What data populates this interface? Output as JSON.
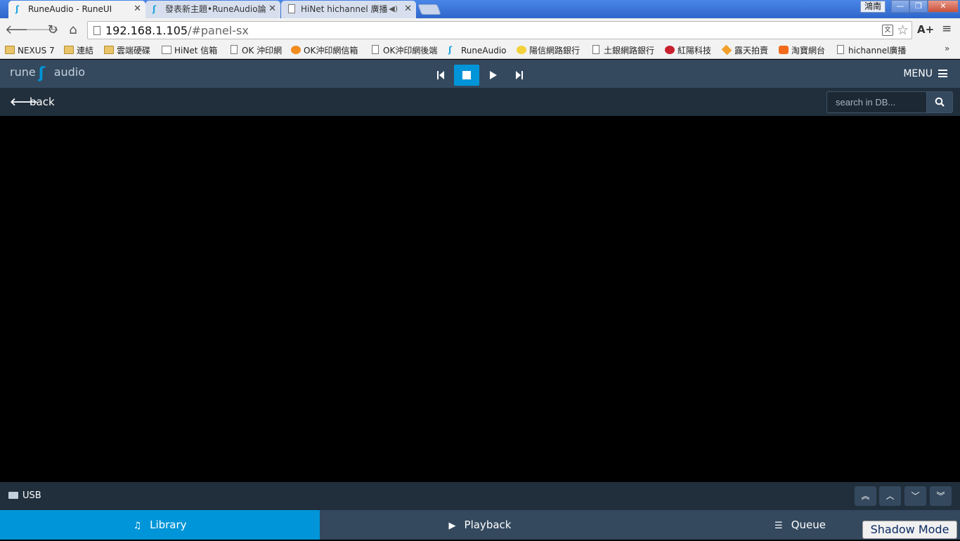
{
  "browser": {
    "tabs": [
      {
        "title": "RuneAudio - RuneUI",
        "active": true
      },
      {
        "title": "發表新主題•RuneAudio論",
        "active": false
      },
      {
        "title": "HiNet hichannel 廣播",
        "active": false
      }
    ],
    "window_user": "鴻南",
    "url_host": "192.168.1.105",
    "url_path": "/#panel-sx",
    "bookmarks": [
      {
        "label": "NEXUS 7",
        "icon": "folder-icon"
      },
      {
        "label": "連結",
        "icon": "folder-icon"
      },
      {
        "label": "雲端硬碟",
        "icon": "folder-icon"
      },
      {
        "label": "HiNet 信箱",
        "icon": "mail-icon"
      },
      {
        "label": "OK 沖印網",
        "icon": "page-icon"
      },
      {
        "label": "OK沖印網信箱",
        "icon": "mail-orange-icon"
      },
      {
        "label": "OK沖印網後端",
        "icon": "page-icon"
      },
      {
        "label": "RuneAudio",
        "icon": "rune-icon"
      },
      {
        "label": "陽信網路銀行",
        "icon": "bank-icon"
      },
      {
        "label": "土銀網路銀行",
        "icon": "page-icon"
      },
      {
        "label": "紅陽科技",
        "icon": "red-s-icon"
      },
      {
        "label": "露天拍賣",
        "icon": "ruten-icon"
      },
      {
        "label": "淘寶網台",
        "icon": "taobao-icon"
      },
      {
        "label": "hichannel廣播",
        "icon": "page-icon"
      }
    ]
  },
  "app": {
    "logo_left": "rune",
    "logo_right": "audio",
    "menu_label": "MENU",
    "back_label": "back",
    "search_placeholder": "search in DB...",
    "path_label": "USB",
    "tabs": {
      "library": "Library",
      "playback": "Playback",
      "queue": "Queue"
    },
    "active_control": "stop",
    "active_tab": "library",
    "accent_color": "#0095d8",
    "header_color": "#34495e"
  },
  "overlay": {
    "shadow_mode": "Shadow Mode"
  }
}
